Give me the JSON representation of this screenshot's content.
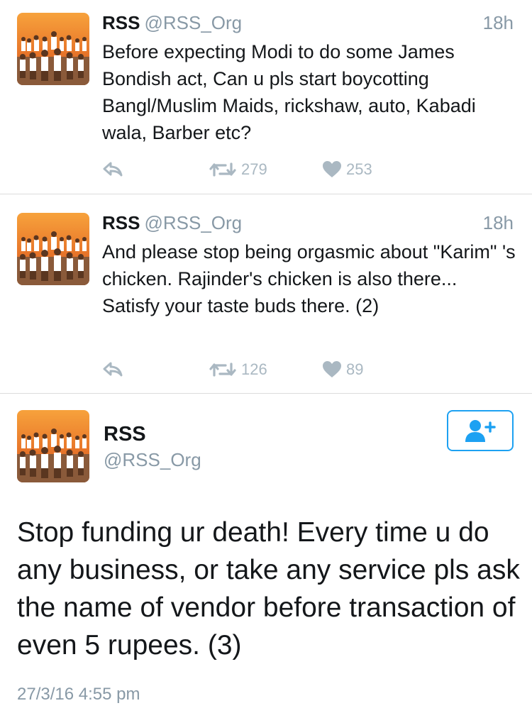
{
  "tweets": [
    {
      "name": "RSS",
      "handle": "@RSS_Org",
      "time": "18h",
      "text": "Before expecting Modi to do some James Bondish act, Can u pls start boycotting Bangl/Muslim Maids, rickshaw, auto, Kabadi wala, Barber etc?",
      "retweets": "279",
      "likes": "253"
    },
    {
      "name": "RSS",
      "handle": "@RSS_Org",
      "time": "18h",
      "text": "And please stop being orgasmic about \"Karim\" 's chicken. Rajinder's chicken is also there... Satisfy your taste buds there. (2)",
      "retweets": "126",
      "likes": "89"
    }
  ],
  "main_tweet": {
    "name": "RSS",
    "handle": "@RSS_Org",
    "text": "Stop funding ur death! Every time u do any business, or take any service pls ask the name of vendor before transaction of even 5 rupees. (3)",
    "timestamp": "27/3/16 4:55 pm"
  },
  "icons": {
    "reply": "reply-icon",
    "retweet": "retweet-icon",
    "like": "heart-icon",
    "follow": "add-user-icon"
  },
  "colors": {
    "accent": "#1da1f2",
    "muted_text": "#8899a6",
    "action_icons": "#aab8c2",
    "divider": "#dcdcdc"
  }
}
